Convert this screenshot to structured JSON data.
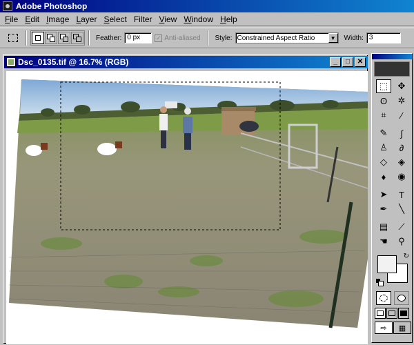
{
  "app": {
    "title": "Adobe Photoshop"
  },
  "menu": [
    {
      "u": "F",
      "rest": "ile"
    },
    {
      "u": "E",
      "rest": "dit"
    },
    {
      "u": "I",
      "rest": "mage"
    },
    {
      "u": "L",
      "rest": "ayer"
    },
    {
      "u": "S",
      "rest": "elect"
    },
    {
      "u": "",
      "rest": "Filter"
    },
    {
      "u": "V",
      "rest": "iew"
    },
    {
      "u": "W",
      "rest": "indow"
    },
    {
      "u": "H",
      "rest": "elp"
    }
  ],
  "options": {
    "feather_label": "Feather:",
    "feather_value": "0 px",
    "antialiased_label": "Anti-aliased",
    "style_label": "Style:",
    "style_value": "Constrained Aspect Ratio",
    "width_label": "Width:",
    "width_value": "3"
  },
  "document": {
    "title": "Dsc_0135.tif @ 16.7% (RGB)"
  },
  "colors": {
    "titlebar_start": "#000080",
    "titlebar_end": "#1084d0",
    "chrome": "#c0c0c0"
  },
  "tool_icons": [
    "marquee-icon",
    "move-icon",
    "lasso-icon",
    "magic-wand-icon",
    "crop-icon",
    "slice-icon",
    "healing-brush-icon",
    "brush-icon",
    "stamp-icon",
    "history-brush-icon",
    "eraser-icon",
    "paint-bucket-icon",
    "blur-icon",
    "dodge-icon",
    "path-select-icon",
    "type-icon",
    "pen-icon",
    "line-icon",
    "notes-icon",
    "eyedropper-icon",
    "hand-icon",
    "zoom-icon"
  ]
}
